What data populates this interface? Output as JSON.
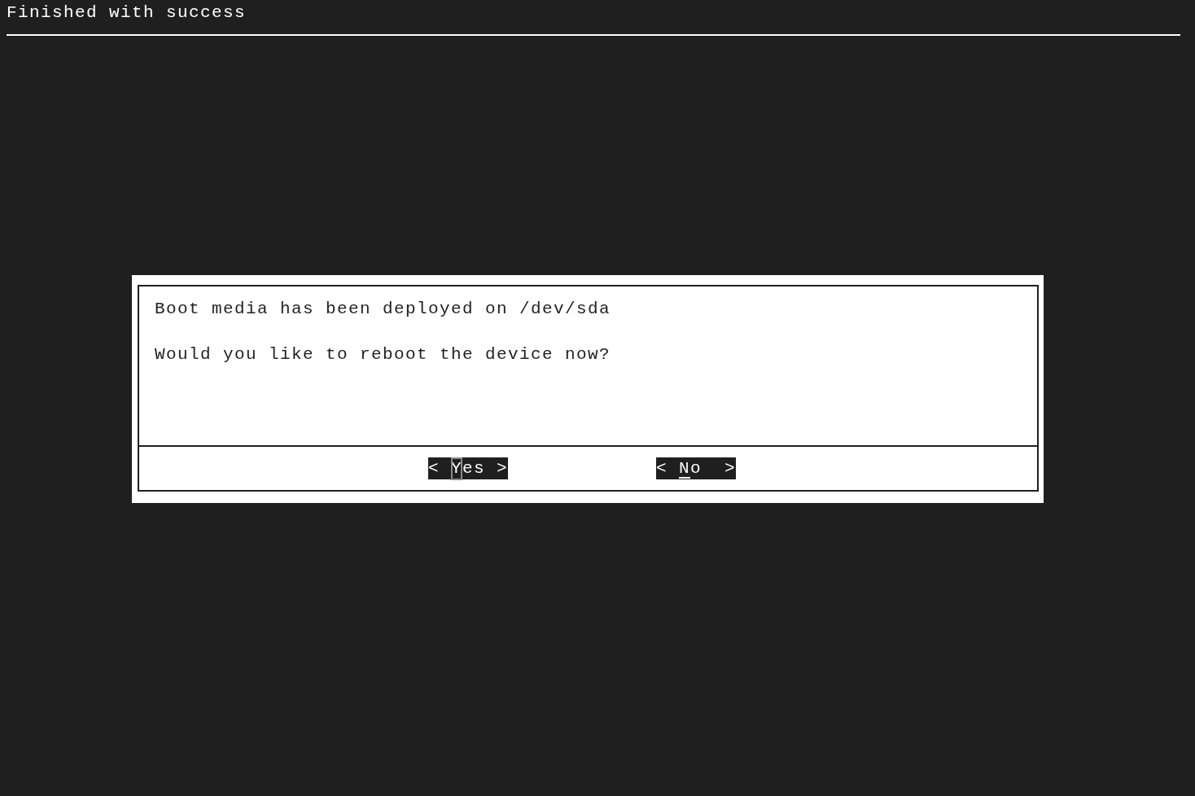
{
  "header": {
    "title": "Finished with success"
  },
  "dialog": {
    "message": [
      "Boot media has been deployed on /dev/sda",
      "Would you like to reboot the device now?"
    ],
    "buttons": [
      {
        "left": "<",
        "label": "Yes",
        "right": ">",
        "selected": true
      },
      {
        "left": "<",
        "label": "No",
        "right": ">",
        "selected": false
      }
    ]
  }
}
